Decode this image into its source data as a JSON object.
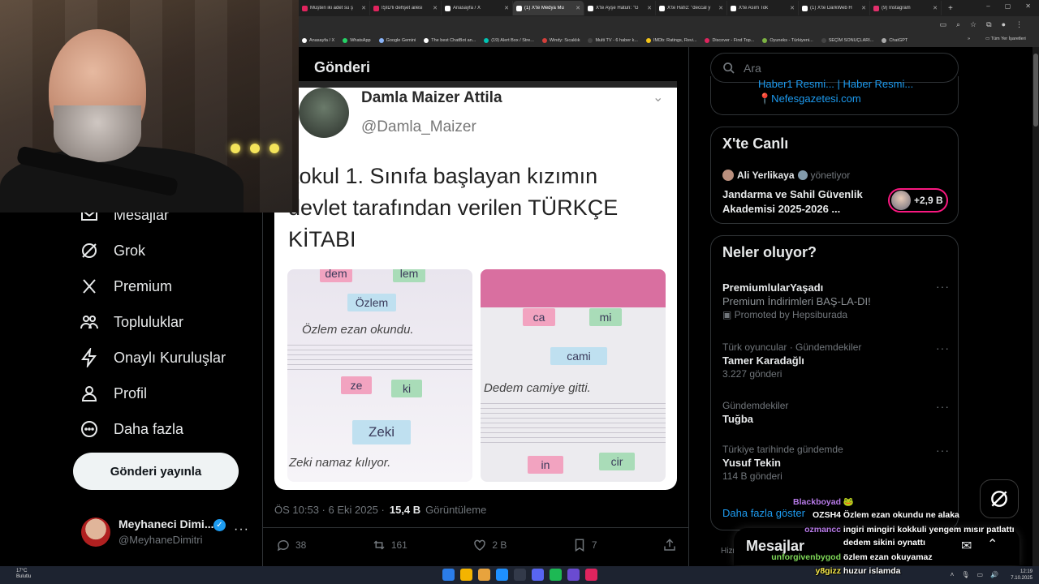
{
  "browser": {
    "tabs": [
      {
        "title": "Müşteri iki adet su ş",
        "color": "#e0245e",
        "active": false
      },
      {
        "title": "IŞİD'li dehşet ailesi",
        "color": "#e0245e",
        "active": false
      },
      {
        "title": "Anasayfa / X",
        "color": "#ffffff",
        "active": false
      },
      {
        "title": "(1) X'te Medya Mu",
        "color": "#ffffff",
        "active": true
      },
      {
        "title": "X'te Ayşe Hatun: \"G",
        "color": "#ffffff",
        "active": false
      },
      {
        "title": "X'te Hafız: \"deccal y",
        "color": "#ffffff",
        "active": false
      },
      {
        "title": "X'te Asım Tok",
        "color": "#ffffff",
        "active": false
      },
      {
        "title": "(1) X'te DarkWeb H",
        "color": "#ffffff",
        "active": false
      },
      {
        "title": "(9) Instagram",
        "color": "#e1306c",
        "active": false
      }
    ],
    "new_tab": "+",
    "window_controls": [
      "–",
      "▢",
      "✕"
    ],
    "bookmarks": [
      {
        "label": "Anasayfa / X",
        "color": "#ffffff"
      },
      {
        "label": "WhatsApp",
        "color": "#25d366"
      },
      {
        "label": "Google Gemini",
        "color": "#8ab4f8"
      },
      {
        "label": "The best ChatBot an...",
        "color": "#ffffff"
      },
      {
        "label": "(19) Alert Box / Stre...",
        "color": "#00c4b4"
      },
      {
        "label": "Windy: Sıcaklık",
        "color": "#d43f3a"
      },
      {
        "label": "Multi TV - 6 haber k...",
        "color": "#444444"
      },
      {
        "label": "IMDb: Ratings, Revi...",
        "color": "#f5c518"
      },
      {
        "label": "Discover - Find Top...",
        "color": "#e0245e"
      },
      {
        "label": "Oyuneks - Türkiyeni...",
        "color": "#7cb342"
      },
      {
        "label": "SEÇİM SONUÇLARI...",
        "color": "#444444"
      },
      {
        "label": "ChatGPT",
        "color": "#aaaaaa"
      }
    ],
    "bookmarks_more": "»",
    "all_bookmarks": "Tüm Yer İşaretleri"
  },
  "nav": {
    "items": [
      {
        "label": "Mesajlar",
        "icon": "envelope-icon"
      },
      {
        "label": "Grok",
        "icon": "grok-icon"
      },
      {
        "label": "Premium",
        "icon": "x-logo-icon"
      },
      {
        "label": "Topluluklar",
        "icon": "communities-icon"
      },
      {
        "label": "Onaylı Kuruluşlar",
        "icon": "lightning-icon"
      },
      {
        "label": "Profil",
        "icon": "person-icon"
      },
      {
        "label": "Daha fazla",
        "icon": "more-circle-icon"
      }
    ],
    "post_button": "Gönderi yayınla",
    "account": {
      "name": "Meyhaneci Dimi...",
      "handle": "@MeyhaneDimitri",
      "more": "···"
    }
  },
  "main": {
    "header": "Gönderi",
    "image_post": {
      "author": "Damla Maizer Attila",
      "handle": "@Damla_Maizer",
      "text_line1": "kokul 1. Sınıfa başlayan kızımın",
      "text_line2": "devlet tarafından verilen TÜRKÇE",
      "text_line3": "KİTABI",
      "left_page": {
        "cards_top": [
          "dem",
          "lem"
        ],
        "word": "Özlem",
        "sentence": "Özlem  ezan okundu.",
        "cards_bottom": [
          "ze",
          "ki"
        ],
        "word2": "Zeki",
        "sentence2": "Zeki  namaz kılıyor."
      },
      "right_page": {
        "cards_top": [
          "ca",
          "mi"
        ],
        "word": "cami",
        "sentence": "Dedem  camiye gitti.",
        "cards_bottom": [
          "in",
          "cir"
        ]
      }
    },
    "meta": {
      "time": "ÖS 10:53 · 6 Eki 2025 ·",
      "views": "15,4 B",
      "views_label": "Görüntüleme"
    },
    "actions": {
      "replies": "38",
      "reposts": "161",
      "likes": "2 B",
      "bookmarks": "7"
    }
  },
  "right": {
    "search_placeholder": "Ara",
    "news_fragment": {
      "line1": "Haber1 Resmi...  |  Haber Resmi...",
      "line2": "📍Nefesgazetesi.com"
    },
    "live": {
      "title": "X'te Canlı",
      "host": "Ali Yerlikaya",
      "host_role": "yönetiyor",
      "space_title": "Jandarma ve Sahil Güvenlik Akademisi 2025-2026 ...",
      "listeners": "+2,9 B"
    },
    "trends": {
      "title": "Neler oluyor?",
      "items": [
        {
          "context": "",
          "name": "PremiumlularYaşadı",
          "count": "Premium İndirimleri BAŞ-LA-DI!",
          "promo": "Promoted by Hepsiburada"
        },
        {
          "context": "Türk oyuncular · Gündemdekiler",
          "name": "Tamer Karadağlı",
          "count": "3.227 gönderi",
          "promo": ""
        },
        {
          "context": "Gündemdekiler",
          "name": "Tuğba",
          "count": "",
          "promo": ""
        },
        {
          "context": "Türkiye tarihinde gündemde",
          "name": "Yusuf Tekin",
          "count": "114 B gönderi",
          "promo": ""
        }
      ],
      "show_more": "Daha fazla göster"
    },
    "footer_partial": "Hizm",
    "messages_drawer": "Mesajlar"
  },
  "chat": [
    {
      "user": "Blackboyad",
      "color": "#b77ae8",
      "msg": "🐸"
    },
    {
      "user": "OZSH4",
      "color": "#ffffff",
      "msg": "Özlem ezan okundu ne alaka"
    },
    {
      "user": "ozmancc",
      "color": "#b77ae8",
      "msg": "ingiri mingiri kokkuli yengem mısır patlattı"
    },
    {
      "user": "",
      "color": "#ffffff",
      "msg": "dedem sikini oynattı"
    },
    {
      "user": "unforgivenbygod",
      "color": "#7fd858",
      "msg": "özlem ezan okuyamaz"
    },
    {
      "user": "y8gizz",
      "color": "#f7e94a",
      "msg": "huzur islamda"
    }
  ],
  "taskbar": {
    "weather_temp": "17°C",
    "weather_desc": "Bulutlu",
    "time": "12:19",
    "date": "7.10.2025",
    "app_colors": [
      "#2b7de9",
      "#f4b400",
      "#e8a33d",
      "#1e90ff",
      "#333a4a",
      "#5865f2",
      "#1db954",
      "#6a4bd1",
      "#e0245e"
    ]
  }
}
